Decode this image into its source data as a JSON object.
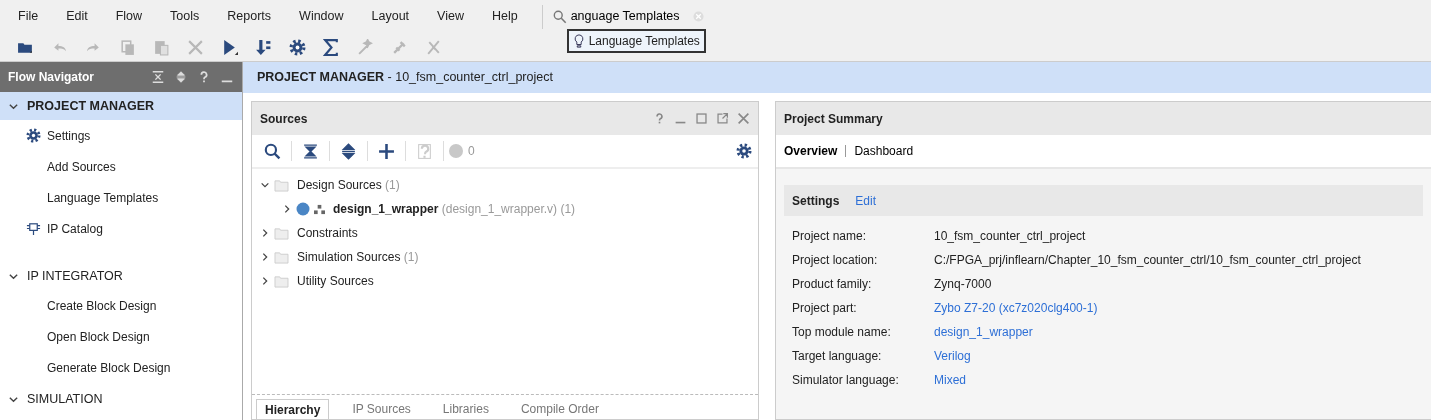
{
  "menu": [
    {
      "label": "File"
    },
    {
      "label": "Edit"
    },
    {
      "label": "Flow"
    },
    {
      "label": "Tools"
    },
    {
      "label": "Reports"
    },
    {
      "label": "Window"
    },
    {
      "label": "Layout"
    },
    {
      "label": "View"
    },
    {
      "label": "Help"
    }
  ],
  "search": {
    "value": "anguage Templates"
  },
  "search_suggestion": {
    "label": "Language Templates"
  },
  "toolbar": [
    {
      "kind": "open",
      "disabled": false
    },
    {
      "kind": "undo",
      "disabled": true
    },
    {
      "kind": "redo",
      "disabled": true
    },
    {
      "kind": "copy",
      "disabled": true
    },
    {
      "kind": "paste",
      "disabled": true
    },
    {
      "kind": "delete",
      "disabled": true
    },
    {
      "kind": "run",
      "disabled": false
    },
    {
      "kind": "bitstream",
      "disabled": false
    },
    {
      "kind": "settings",
      "disabled": false
    },
    {
      "kind": "sum",
      "disabled": false
    },
    {
      "kind": "wand",
      "disabled": true
    },
    {
      "kind": "probe",
      "disabled": true
    },
    {
      "kind": "pin",
      "disabled": true
    }
  ],
  "flow_navigator": {
    "title": "Flow Navigator",
    "sections": [
      {
        "label": "PROJECT MANAGER",
        "expanded": true,
        "selected": true,
        "items": [
          {
            "label": "Settings",
            "kind": "gear"
          },
          {
            "label": "Add Sources",
            "kind": "plain"
          },
          {
            "label": "Language Templates",
            "kind": "plain"
          },
          {
            "label": "IP Catalog",
            "kind": "chip"
          }
        ]
      },
      {
        "label": "IP INTEGRATOR",
        "expanded": true,
        "selected": false,
        "items": [
          {
            "label": "Create Block Design",
            "kind": "plain"
          },
          {
            "label": "Open Block Design",
            "kind": "plain"
          },
          {
            "label": "Generate Block Design",
            "kind": "plain"
          }
        ]
      },
      {
        "label": "SIMULATION",
        "expanded": true,
        "selected": false
      }
    ]
  },
  "main_header": {
    "title": "**PROJECT MANAGER** - 10_fsm_counter_ctrl_project"
  },
  "sources": {
    "title": "Sources",
    "count": "0",
    "tree": [
      {
        "label": "Design Sources",
        "count": "(1)",
        "kind": "folder",
        "expanded": true,
        "children": [
          {
            "label": "design_1_wrapper",
            "count": "(design_1_wrapper.v) (1)",
            "kind": "module",
            "expanded": false
          }
        ]
      },
      {
        "label": "Constraints",
        "kind": "folder",
        "expanded": false
      },
      {
        "label": "Simulation Sources",
        "count": "(1)",
        "kind": "folder",
        "expanded": false
      },
      {
        "label": "Utility Sources",
        "kind": "folder",
        "expanded": false
      }
    ],
    "tabs": [
      {
        "label": "Hierarchy",
        "selected": true
      },
      {
        "label": "IP Sources",
        "selected": false
      },
      {
        "label": "Libraries",
        "selected": false
      },
      {
        "label": "Compile Order",
        "selected": false
      }
    ]
  },
  "summary": {
    "title": "Project Summary",
    "tabs": [
      {
        "label": "Overview",
        "selected": true
      },
      {
        "label": "Dashboard",
        "selected": false
      }
    ],
    "section": {
      "title": "Settings",
      "action": "Edit"
    },
    "rows": [
      {
        "label": "Project name:",
        "value": "10_fsm_counter_ctrl_project",
        "link": false
      },
      {
        "label": "Project location:",
        "value": "C:/FPGA_prj/inflearn/Chapter_10_fsm_counter_ctrl/10_fsm_counter_ctrl_project",
        "link": false
      },
      {
        "label": "Product family:",
        "value": "Zynq-7000",
        "link": false
      },
      {
        "label": "Project part:",
        "value": "Zybo Z7-20 (xc7z020clg400-1)",
        "link": true
      },
      {
        "label": "Top module name:",
        "value": "design_1_wrapper",
        "link": true
      },
      {
        "label": "Target language:",
        "value": "Verilog",
        "link": true
      },
      {
        "label": "Simulator language:",
        "value": "Mixed",
        "link": true
      }
    ]
  }
}
